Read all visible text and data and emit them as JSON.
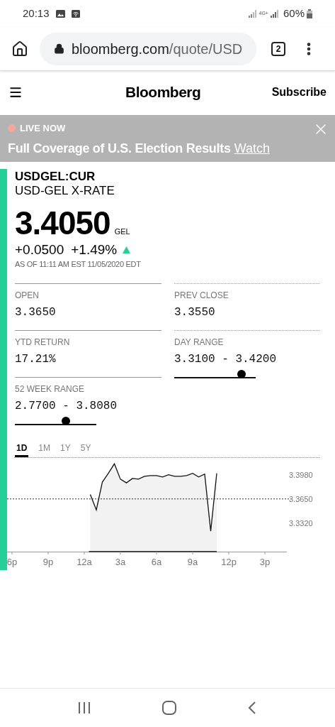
{
  "status_bar": {
    "time": "20:13",
    "network": "4G+",
    "battery": "60%"
  },
  "browser": {
    "url_host": "bloomberg.com",
    "url_path": "/quote/USD",
    "tab_count": "2"
  },
  "site_header": {
    "logo": "Bloomberg",
    "subscribe": "Subscribe"
  },
  "banner": {
    "label": "LIVE NOW",
    "headline": "Full Coverage of U.S. Election Results",
    "link": "Watch"
  },
  "quote": {
    "ticker": "USDGEL:CUR",
    "name": "USD-GEL X-RATE",
    "price": "3.4050",
    "currency": "GEL",
    "change": "+0.0500",
    "change_pct": "+1.49%",
    "up": true,
    "as_of": "AS OF 11:11 AM EST 11/05/2020 EDT"
  },
  "stats": [
    {
      "kind": "value",
      "label": "OPEN",
      "value": "3.3650"
    },
    {
      "kind": "value",
      "label": "PREV CLOSE",
      "value": "3.3550"
    },
    {
      "kind": "value",
      "label": "YTD RETURN",
      "value": "17.21%"
    },
    {
      "kind": "range",
      "label": "DAY RANGE",
      "value": "3.3100 - 3.4200",
      "level": 0.83
    },
    {
      "kind": "range",
      "label": "52 WEEK RANGE",
      "value": "2.7700 - 3.8080",
      "level": 0.63
    }
  ],
  "chart_tabs": [
    {
      "label": "1D",
      "selected": true
    },
    {
      "label": "1M",
      "selected": false
    },
    {
      "label": "1Y",
      "selected": false
    },
    {
      "label": "5Y",
      "selected": false
    }
  ],
  "chart_data": {
    "type": "area",
    "categories": [
      "6p",
      null,
      null,
      null,
      null,
      null,
      "9p",
      null,
      null,
      null,
      null,
      null,
      "12a",
      null,
      null,
      null,
      null,
      null,
      "3a",
      null,
      null,
      null,
      null,
      null,
      "6a",
      null,
      null,
      null,
      null,
      null,
      "9a",
      null,
      null,
      null,
      null,
      null,
      "12p",
      null,
      null,
      null,
      null,
      null,
      "3p",
      null,
      null,
      null
    ],
    "series": [
      {
        "color": "#111111",
        "values": [
          null,
          null,
          null,
          null,
          null,
          null,
          null,
          null,
          null,
          null,
          null,
          null,
          null,
          3.371,
          3.35,
          3.388,
          3.4,
          3.413,
          3.392,
          3.387,
          3.393,
          3.392,
          3.396,
          3.397,
          3.397,
          3.395,
          3.398,
          3.396,
          3.396,
          3.397,
          3.4,
          3.395,
          3.399,
          3.321,
          3.4,
          null,
          null,
          null,
          null,
          null,
          null,
          null,
          null,
          null,
          null,
          null
        ]
      }
    ],
    "ylim": [
      3.293,
      3.422
    ],
    "yticks": [
      {
        "value": 3.398,
        "label": "3.3980"
      },
      {
        "value": 3.365,
        "label": "3.3650"
      },
      {
        "value": 3.332,
        "label": "3.3320"
      }
    ]
  }
}
